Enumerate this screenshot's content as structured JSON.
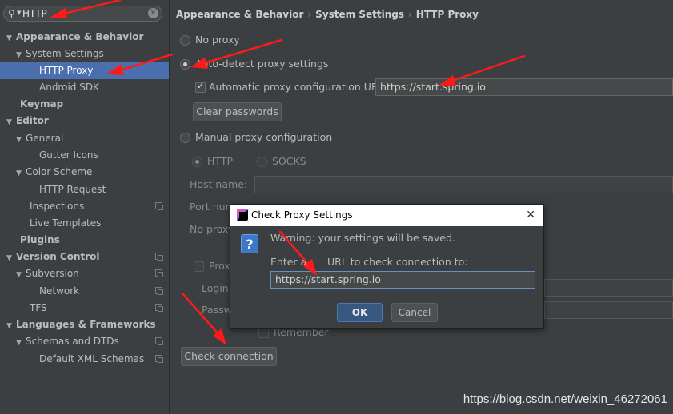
{
  "search": {
    "query": "HTTP",
    "icon": "search-icon",
    "clear_icon": "clear-icon"
  },
  "sidebar": {
    "items": [
      {
        "label": "Appearance & Behavior",
        "expanded": true
      },
      {
        "label": "System Settings",
        "expanded": true
      },
      {
        "label": "HTTP Proxy",
        "selected": true
      },
      {
        "label": "Android SDK"
      },
      {
        "label": "Keymap"
      },
      {
        "label": "Editor",
        "expanded": true
      },
      {
        "label": "General",
        "expanded": true
      },
      {
        "label": "Gutter Icons"
      },
      {
        "label": "Color Scheme",
        "expanded": true
      },
      {
        "label": "HTTP Request"
      },
      {
        "label": "Inspections"
      },
      {
        "label": "Live Templates"
      },
      {
        "label": "Plugins"
      },
      {
        "label": "Version Control",
        "expanded": true
      },
      {
        "label": "Subversion",
        "expanded": true
      },
      {
        "label": "Network"
      },
      {
        "label": "TFS"
      },
      {
        "label": "Languages & Frameworks",
        "expanded": true
      },
      {
        "label": "Schemas and DTDs",
        "expanded": true
      },
      {
        "label": "Default XML Schemas"
      }
    ]
  },
  "breadcrumb": {
    "items": [
      "Appearance & Behavior",
      "System Settings",
      "HTTP Proxy"
    ],
    "separator": "›"
  },
  "proxy": {
    "no_proxy": "No proxy",
    "auto_detect": "Auto-detect proxy settings",
    "auto_config_url_label": "Automatic proxy configuration URL:",
    "auto_config_url_value": "https://start.spring.io",
    "clear_passwords": "Clear passwords",
    "manual": "Manual proxy configuration",
    "http": "HTTP",
    "socks": "SOCKS",
    "host_name": "Host name:",
    "port_number_partial": "Port num",
    "no_proxy_partial": "No proxy",
    "proxy_auth_partial": "Prox",
    "login_partial": "Login:",
    "password_partial": "Passwo",
    "remember": "Remember",
    "check_connection": "Check connection"
  },
  "dialog": {
    "title": "Check Proxy Settings",
    "close": "✕",
    "question_glyph": "?",
    "warning": "Warning: your settings will be saved.",
    "prompt_part1": "Enter a",
    "prompt_part2": "URL to check connection to:",
    "url_value": "https://start.spring.io",
    "ok": "OK",
    "cancel": "Cancel"
  },
  "watermark": "https://blog.csdn.net/weixin_46272061",
  "colors": {
    "background": "#3c3f41",
    "selection": "#4b6eaf",
    "annotation_arrow": "#ff1a1a",
    "ok_button": "#365880"
  }
}
